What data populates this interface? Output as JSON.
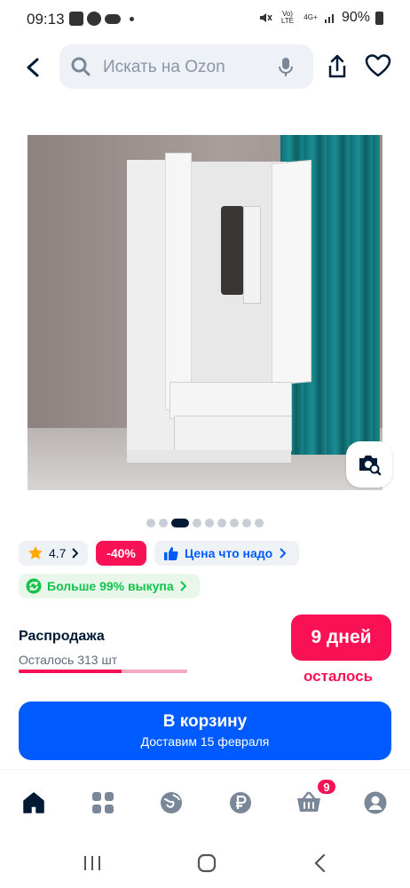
{
  "status_bar": {
    "time": "09:13",
    "battery": "90%",
    "network": "4G+",
    "volte": "Vo) LTE"
  },
  "header": {
    "search_placeholder": "Искать на Ozon"
  },
  "gallery": {
    "image_alt": "Белый двухстворчатый шкаф с ящиками",
    "slides": 9,
    "active_slide": 3
  },
  "chips": {
    "rating": "4.7",
    "discount": "-40%",
    "price_tag": "Цена что надо",
    "buyout": "Больше 99% выкупа"
  },
  "sale": {
    "title": "Распродажа",
    "stock_left": "Осталось 313 шт",
    "progress": 0.61,
    "days_badge": "9 дней",
    "days_caption": "осталось"
  },
  "cart_button": {
    "label": "В корзину",
    "delivery": "Доставим 15 февраля"
  },
  "bottom_nav": {
    "items": [
      "home-icon",
      "catalog-icon",
      "fresh-icon",
      "ruble-icon",
      "cart-icon",
      "profile-icon"
    ],
    "cart_count": "9"
  },
  "colors": {
    "brand_blue": "#005bff",
    "accent_pink": "#f91155",
    "green": "#10c44c",
    "text_dark": "#001a34"
  }
}
